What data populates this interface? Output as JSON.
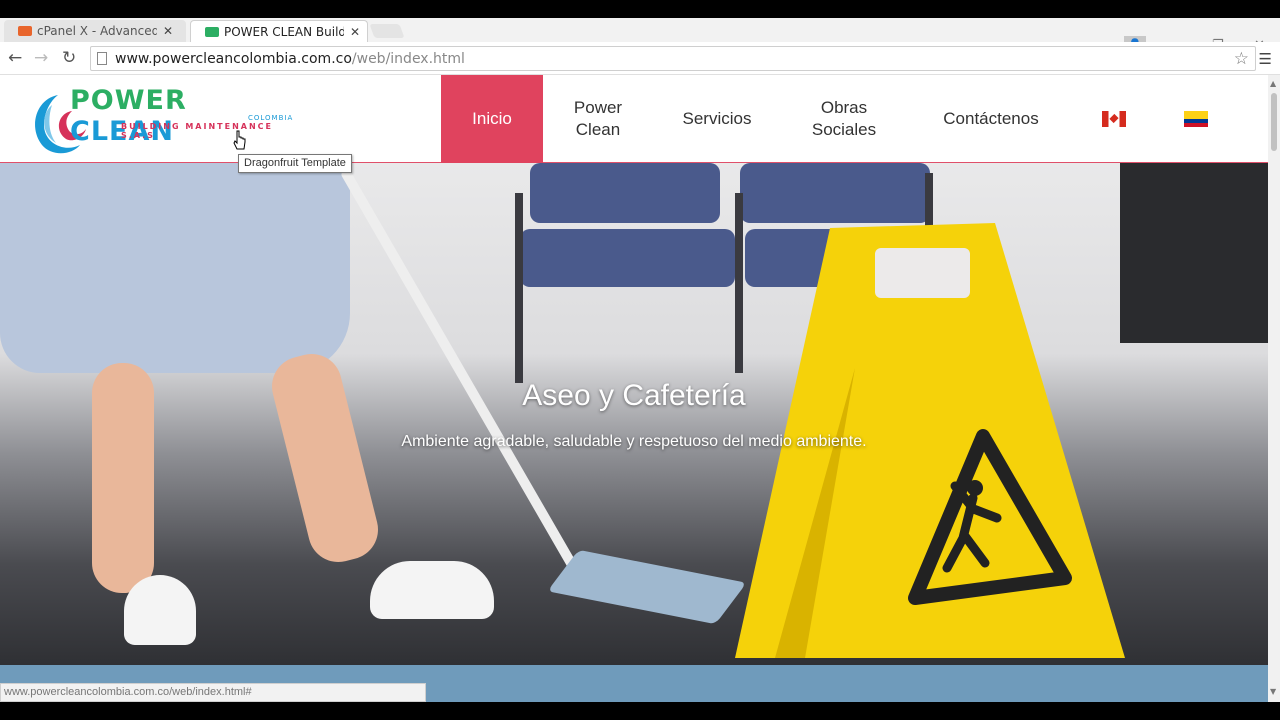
{
  "browser": {
    "tabs": [
      {
        "title": "cPanel X - Advanced DNS",
        "active": false
      },
      {
        "title": "POWER CLEAN Building M",
        "active": true
      }
    ],
    "url_host": "www.powercleancolombia.com.co",
    "url_path": "/web/index.html",
    "status_url": "www.powercleancolombia.com.co/web/index.html#"
  },
  "logo": {
    "power": "POWER",
    "clean": "CLEAN",
    "colombia": "COLOMBIA",
    "subtitle": "BUILDING MAINTENANCE S.A.S"
  },
  "nav": {
    "items": [
      {
        "line1": "Inicio",
        "line2": ""
      },
      {
        "line1": "Power",
        "line2": "Clean"
      },
      {
        "line1": "Servicios",
        "line2": ""
      },
      {
        "line1": "Obras",
        "line2": "Sociales"
      },
      {
        "line1": "Contáctenos",
        "line2": ""
      }
    ]
  },
  "tooltip": "Dragonfruit Template",
  "hero": {
    "title": "Aseo y Cafetería",
    "subtitle": "Ambiente agradable, saludable y respetuoso del medio ambiente."
  },
  "colors": {
    "accent": "#e0435e",
    "logo_green": "#2cae63",
    "logo_blue": "#1a9ad6",
    "band": "#6f9bbb"
  }
}
